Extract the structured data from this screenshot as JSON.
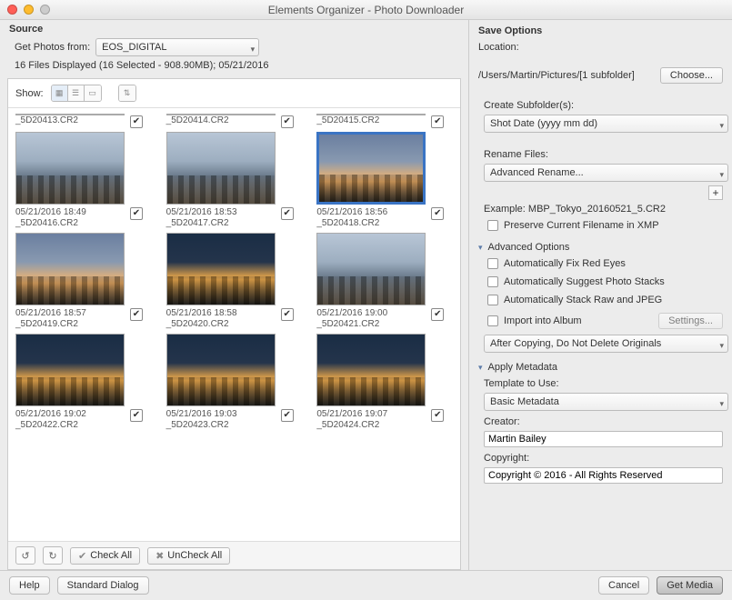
{
  "window": {
    "title": "Elements Organizer - Photo Downloader"
  },
  "source": {
    "header": "Source",
    "get_from_label": "Get Photos from:",
    "device": "EOS_DIGITAL",
    "summary": "16 Files Displayed (16 Selected - 908.90MB); 05/21/2016",
    "show_label": "Show:"
  },
  "thumbnails": [
    {
      "date": "",
      "file": "_5D20413.CR2",
      "checked": true,
      "toprow": true
    },
    {
      "date": "",
      "file": "_5D20414.CR2",
      "checked": true,
      "toprow": true
    },
    {
      "date": "",
      "file": "_5D20415.CR2",
      "checked": true,
      "toprow": true
    },
    {
      "date": "05/21/2016 18:49",
      "file": "_5D20416.CR2",
      "checked": true,
      "variant": "sky"
    },
    {
      "date": "05/21/2016 18:53",
      "file": "_5D20417.CR2",
      "checked": true,
      "variant": "sky"
    },
    {
      "date": "05/21/2016 18:56",
      "file": "_5D20418.CR2",
      "checked": true,
      "variant": "dusk",
      "selected": true
    },
    {
      "date": "05/21/2016 18:57",
      "file": "_5D20419.CR2",
      "checked": true,
      "variant": "dusk"
    },
    {
      "date": "05/21/2016 18:58",
      "file": "_5D20420.CR2",
      "checked": true,
      "variant": "night"
    },
    {
      "date": "05/21/2016 19:00",
      "file": "_5D20421.CR2",
      "checked": true,
      "variant": "sky"
    },
    {
      "date": "05/21/2016 19:02",
      "file": "_5D20422.CR2",
      "checked": true,
      "variant": "night"
    },
    {
      "date": "05/21/2016 19:03",
      "file": "_5D20423.CR2",
      "checked": true,
      "variant": "night"
    },
    {
      "date": "05/21/2016 19:07",
      "file": "_5D20424.CR2",
      "checked": true,
      "variant": "night"
    }
  ],
  "toolbar": {
    "check_all": "Check All",
    "uncheck_all": "UnCheck All"
  },
  "save": {
    "header": "Save Options",
    "location_label": "Location:",
    "location_path": "/Users/Martin/Pictures/[1 subfolder]",
    "choose": "Choose...",
    "create_subfolder_label": "Create Subfolder(s):",
    "create_subfolder_value": "Shot Date (yyyy mm dd)",
    "rename_label": "Rename Files:",
    "rename_value": "Advanced Rename...",
    "example_label": "Example:",
    "example_value": "MBP_Tokyo_20160521_5.CR2",
    "preserve_xmp": "Preserve Current Filename in XMP"
  },
  "advanced": {
    "header": "Advanced Options",
    "fix_red_eyes": "Automatically Fix Red Eyes",
    "suggest_stacks": "Automatically Suggest Photo Stacks",
    "stack_raw_jpeg": "Automatically Stack Raw and JPEG",
    "import_album": "Import into Album",
    "settings": "Settings...",
    "delete_policy": "After Copying, Do Not Delete Originals"
  },
  "metadata": {
    "header": "Apply Metadata",
    "template_label": "Template to Use:",
    "template_value": "Basic Metadata",
    "creator_label": "Creator:",
    "creator_value": "Martin Bailey",
    "copyright_label": "Copyright:",
    "copyright_value": "Copyright © 2016 - All Rights Reserved"
  },
  "footer": {
    "help": "Help",
    "standard": "Standard Dialog",
    "cancel": "Cancel",
    "get_media": "Get Media"
  }
}
